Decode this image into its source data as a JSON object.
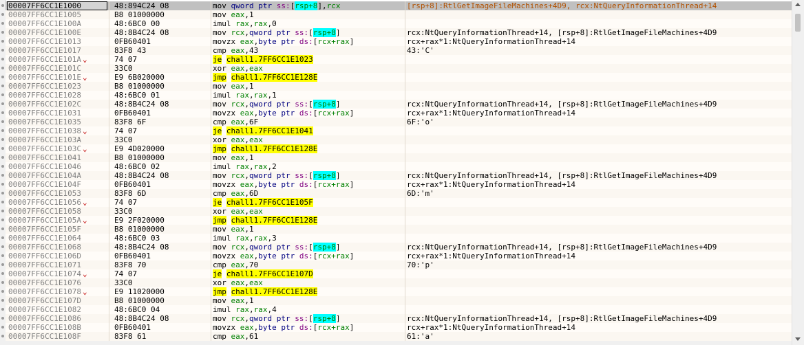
{
  "rows": [
    {
      "addr": "00007FF6CC1E1000",
      "bytes": "48:894C24 08",
      "ins": [
        [
          "mnem",
          "mov "
        ],
        [
          "kw",
          "qword ptr "
        ],
        [
          "seg",
          "ss:"
        ],
        [
          "br",
          "["
        ],
        [
          "regc",
          "rsp+8"
        ],
        [
          "br",
          "]"
        ],
        [
          "br",
          ","
        ],
        [
          "reg",
          "rcx"
        ]
      ],
      "cmt": "[rsp+8]:RtlGetImageFileMachines+4D9, rcx:NtQueryInformationThread+14",
      "cmt_color": "orange",
      "selected": true,
      "arrow": ""
    },
    {
      "addr": "00007FF6CC1E1005",
      "bytes": "B8 01000000",
      "ins": [
        [
          "mnem",
          "mov "
        ],
        [
          "reg",
          "eax"
        ],
        [
          "br",
          ","
        ],
        [
          "num",
          "1"
        ]
      ],
      "cmt": "",
      "arrow": ""
    },
    {
      "addr": "00007FF6CC1E100A",
      "bytes": "48:6BC0 00",
      "ins": [
        [
          "mnem",
          "imul "
        ],
        [
          "reg",
          "rax"
        ],
        [
          "br",
          ","
        ],
        [
          "reg",
          "rax"
        ],
        [
          "br",
          ","
        ],
        [
          "num",
          "0"
        ]
      ],
      "cmt": "",
      "arrow": ""
    },
    {
      "addr": "00007FF6CC1E100E",
      "bytes": "48:8B4C24 08",
      "ins": [
        [
          "mnem",
          "mov "
        ],
        [
          "reg",
          "rcx"
        ],
        [
          "br",
          ","
        ],
        [
          "kw",
          "qword ptr "
        ],
        [
          "seg",
          "ss:"
        ],
        [
          "br",
          "["
        ],
        [
          "regc",
          "rsp+8"
        ],
        [
          "br",
          "]"
        ]
      ],
      "cmt": "rcx:NtQueryInformationThread+14, [rsp+8]:RtlGetImageFileMachines+4D9",
      "arrow": ""
    },
    {
      "addr": "00007FF6CC1E1013",
      "bytes": "0FB60401",
      "ins": [
        [
          "mnem",
          "movzx "
        ],
        [
          "reg",
          "eax"
        ],
        [
          "br",
          ","
        ],
        [
          "kw",
          "byte ptr "
        ],
        [
          "seg",
          "ds:"
        ],
        [
          "br",
          "["
        ],
        [
          "reg",
          "rcx+rax"
        ],
        [
          "br",
          "]"
        ]
      ],
      "cmt": "rcx+rax*1:NtQueryInformationThread+14",
      "arrow": ""
    },
    {
      "addr": "00007FF6CC1E1017",
      "bytes": "83F8 43",
      "ins": [
        [
          "mnem",
          "cmp "
        ],
        [
          "reg",
          "eax"
        ],
        [
          "br",
          ","
        ],
        [
          "num",
          "43"
        ]
      ],
      "cmt": "43:'C'",
      "arrow": ""
    },
    {
      "addr": "00007FF6CC1E101A",
      "bytes": "74 07",
      "ins": [
        [
          "hl",
          "je"
        ],
        [
          "br",
          " "
        ],
        [
          "tgt",
          "chall1.7FF6CC1E1023"
        ]
      ],
      "cmt": "",
      "arrow": "⌄"
    },
    {
      "addr": "00007FF6CC1E101C",
      "bytes": "33C0",
      "ins": [
        [
          "mnem",
          "xor "
        ],
        [
          "reg",
          "eax"
        ],
        [
          "br",
          ","
        ],
        [
          "reg",
          "eax"
        ]
      ],
      "cmt": "",
      "arrow": ""
    },
    {
      "addr": "00007FF6CC1E101E",
      "bytes": "E9 6B020000",
      "ins": [
        [
          "hl",
          "jmp"
        ],
        [
          "br",
          " "
        ],
        [
          "tgt",
          "chall1.7FF6CC1E128E"
        ]
      ],
      "cmt": "",
      "arrow": "⌄"
    },
    {
      "addr": "00007FF6CC1E1023",
      "bytes": "B8 01000000",
      "ins": [
        [
          "mnem",
          "mov "
        ],
        [
          "reg",
          "eax"
        ],
        [
          "br",
          ","
        ],
        [
          "num",
          "1"
        ]
      ],
      "cmt": "",
      "arrow": ""
    },
    {
      "addr": "00007FF6CC1E1028",
      "bytes": "48:6BC0 01",
      "ins": [
        [
          "mnem",
          "imul "
        ],
        [
          "reg",
          "rax"
        ],
        [
          "br",
          ","
        ],
        [
          "reg",
          "rax"
        ],
        [
          "br",
          ","
        ],
        [
          "num",
          "1"
        ]
      ],
      "cmt": "",
      "arrow": ""
    },
    {
      "addr": "00007FF6CC1E102C",
      "bytes": "48:8B4C24 08",
      "ins": [
        [
          "mnem",
          "mov "
        ],
        [
          "reg",
          "rcx"
        ],
        [
          "br",
          ","
        ],
        [
          "kw",
          "qword ptr "
        ],
        [
          "seg",
          "ss:"
        ],
        [
          "br",
          "["
        ],
        [
          "regc",
          "rsp+8"
        ],
        [
          "br",
          "]"
        ]
      ],
      "cmt": "rcx:NtQueryInformationThread+14, [rsp+8]:RtlGetImageFileMachines+4D9",
      "arrow": ""
    },
    {
      "addr": "00007FF6CC1E1031",
      "bytes": "0FB60401",
      "ins": [
        [
          "mnem",
          "movzx "
        ],
        [
          "reg",
          "eax"
        ],
        [
          "br",
          ","
        ],
        [
          "kw",
          "byte ptr "
        ],
        [
          "seg",
          "ds:"
        ],
        [
          "br",
          "["
        ],
        [
          "reg",
          "rcx+rax"
        ],
        [
          "br",
          "]"
        ]
      ],
      "cmt": "rcx+rax*1:NtQueryInformationThread+14",
      "arrow": ""
    },
    {
      "addr": "00007FF6CC1E1035",
      "bytes": "83F8 6F",
      "ins": [
        [
          "mnem",
          "cmp "
        ],
        [
          "reg",
          "eax"
        ],
        [
          "br",
          ","
        ],
        [
          "num",
          "6F"
        ]
      ],
      "cmt": "6F:'o'",
      "arrow": ""
    },
    {
      "addr": "00007FF6CC1E1038",
      "bytes": "74 07",
      "ins": [
        [
          "hl",
          "je"
        ],
        [
          "br",
          " "
        ],
        [
          "tgt",
          "chall1.7FF6CC1E1041"
        ]
      ],
      "cmt": "",
      "arrow": "⌄"
    },
    {
      "addr": "00007FF6CC1E103A",
      "bytes": "33C0",
      "ins": [
        [
          "mnem",
          "xor "
        ],
        [
          "reg",
          "eax"
        ],
        [
          "br",
          ","
        ],
        [
          "reg",
          "eax"
        ]
      ],
      "cmt": "",
      "arrow": ""
    },
    {
      "addr": "00007FF6CC1E103C",
      "bytes": "E9 4D020000",
      "ins": [
        [
          "hl",
          "jmp"
        ],
        [
          "br",
          " "
        ],
        [
          "tgt",
          "chall1.7FF6CC1E128E"
        ]
      ],
      "cmt": "",
      "arrow": "⌄"
    },
    {
      "addr": "00007FF6CC1E1041",
      "bytes": "B8 01000000",
      "ins": [
        [
          "mnem",
          "mov "
        ],
        [
          "reg",
          "eax"
        ],
        [
          "br",
          ","
        ],
        [
          "num",
          "1"
        ]
      ],
      "cmt": "",
      "arrow": ""
    },
    {
      "addr": "00007FF6CC1E1046",
      "bytes": "48:6BC0 02",
      "ins": [
        [
          "mnem",
          "imul "
        ],
        [
          "reg",
          "rax"
        ],
        [
          "br",
          ","
        ],
        [
          "reg",
          "rax"
        ],
        [
          "br",
          ","
        ],
        [
          "num",
          "2"
        ]
      ],
      "cmt": "",
      "arrow": ""
    },
    {
      "addr": "00007FF6CC1E104A",
      "bytes": "48:8B4C24 08",
      "ins": [
        [
          "mnem",
          "mov "
        ],
        [
          "reg",
          "rcx"
        ],
        [
          "br",
          ","
        ],
        [
          "kw",
          "qword ptr "
        ],
        [
          "seg",
          "ss:"
        ],
        [
          "br",
          "["
        ],
        [
          "regc",
          "rsp+8"
        ],
        [
          "br",
          "]"
        ]
      ],
      "cmt": "rcx:NtQueryInformationThread+14, [rsp+8]:RtlGetImageFileMachines+4D9",
      "arrow": ""
    },
    {
      "addr": "00007FF6CC1E104F",
      "bytes": "0FB60401",
      "ins": [
        [
          "mnem",
          "movzx "
        ],
        [
          "reg",
          "eax"
        ],
        [
          "br",
          ","
        ],
        [
          "kw",
          "byte ptr "
        ],
        [
          "seg",
          "ds:"
        ],
        [
          "br",
          "["
        ],
        [
          "reg",
          "rcx+rax"
        ],
        [
          "br",
          "]"
        ]
      ],
      "cmt": "rcx+rax*1:NtQueryInformationThread+14",
      "arrow": ""
    },
    {
      "addr": "00007FF6CC1E1053",
      "bytes": "83F8 6D",
      "ins": [
        [
          "mnem",
          "cmp "
        ],
        [
          "reg",
          "eax"
        ],
        [
          "br",
          ","
        ],
        [
          "num",
          "6D"
        ]
      ],
      "cmt": "6D:'m'",
      "arrow": ""
    },
    {
      "addr": "00007FF6CC1E1056",
      "bytes": "74 07",
      "ins": [
        [
          "hl",
          "je"
        ],
        [
          "br",
          " "
        ],
        [
          "tgt",
          "chall1.7FF6CC1E105F"
        ]
      ],
      "cmt": "",
      "arrow": "⌄"
    },
    {
      "addr": "00007FF6CC1E1058",
      "bytes": "33C0",
      "ins": [
        [
          "mnem",
          "xor "
        ],
        [
          "reg",
          "eax"
        ],
        [
          "br",
          ","
        ],
        [
          "reg",
          "eax"
        ]
      ],
      "cmt": "",
      "arrow": ""
    },
    {
      "addr": "00007FF6CC1E105A",
      "bytes": "E9 2F020000",
      "ins": [
        [
          "hl",
          "jmp"
        ],
        [
          "br",
          " "
        ],
        [
          "tgt",
          "chall1.7FF6CC1E128E"
        ]
      ],
      "cmt": "",
      "arrow": "⌄"
    },
    {
      "addr": "00007FF6CC1E105F",
      "bytes": "B8 01000000",
      "ins": [
        [
          "mnem",
          "mov "
        ],
        [
          "reg",
          "eax"
        ],
        [
          "br",
          ","
        ],
        [
          "num",
          "1"
        ]
      ],
      "cmt": "",
      "arrow": ""
    },
    {
      "addr": "00007FF6CC1E1064",
      "bytes": "48:6BC0 03",
      "ins": [
        [
          "mnem",
          "imul "
        ],
        [
          "reg",
          "rax"
        ],
        [
          "br",
          ","
        ],
        [
          "reg",
          "rax"
        ],
        [
          "br",
          ","
        ],
        [
          "num",
          "3"
        ]
      ],
      "cmt": "",
      "arrow": ""
    },
    {
      "addr": "00007FF6CC1E1068",
      "bytes": "48:8B4C24 08",
      "ins": [
        [
          "mnem",
          "mov "
        ],
        [
          "reg",
          "rcx"
        ],
        [
          "br",
          ","
        ],
        [
          "kw",
          "qword ptr "
        ],
        [
          "seg",
          "ss:"
        ],
        [
          "br",
          "["
        ],
        [
          "regc",
          "rsp+8"
        ],
        [
          "br",
          "]"
        ]
      ],
      "cmt": "rcx:NtQueryInformationThread+14, [rsp+8]:RtlGetImageFileMachines+4D9",
      "arrow": ""
    },
    {
      "addr": "00007FF6CC1E106D",
      "bytes": "0FB60401",
      "ins": [
        [
          "mnem",
          "movzx "
        ],
        [
          "reg",
          "eax"
        ],
        [
          "br",
          ","
        ],
        [
          "kw",
          "byte ptr "
        ],
        [
          "seg",
          "ds:"
        ],
        [
          "br",
          "["
        ],
        [
          "reg",
          "rcx+rax"
        ],
        [
          "br",
          "]"
        ]
      ],
      "cmt": "rcx+rax*1:NtQueryInformationThread+14",
      "arrow": ""
    },
    {
      "addr": "00007FF6CC1E1071",
      "bytes": "83F8 70",
      "ins": [
        [
          "mnem",
          "cmp "
        ],
        [
          "reg",
          "eax"
        ],
        [
          "br",
          ","
        ],
        [
          "num",
          "70"
        ]
      ],
      "cmt": "70:'p'",
      "arrow": ""
    },
    {
      "addr": "00007FF6CC1E1074",
      "bytes": "74 07",
      "ins": [
        [
          "hl",
          "je"
        ],
        [
          "br",
          " "
        ],
        [
          "tgt",
          "chall1.7FF6CC1E107D"
        ]
      ],
      "cmt": "",
      "arrow": "⌄"
    },
    {
      "addr": "00007FF6CC1E1076",
      "bytes": "33C0",
      "ins": [
        [
          "mnem",
          "xor "
        ],
        [
          "reg",
          "eax"
        ],
        [
          "br",
          ","
        ],
        [
          "reg",
          "eax"
        ]
      ],
      "cmt": "",
      "arrow": ""
    },
    {
      "addr": "00007FF6CC1E1078",
      "bytes": "E9 11020000",
      "ins": [
        [
          "hl",
          "jmp"
        ],
        [
          "br",
          " "
        ],
        [
          "tgt",
          "chall1.7FF6CC1E128E"
        ]
      ],
      "cmt": "",
      "arrow": "⌄"
    },
    {
      "addr": "00007FF6CC1E107D",
      "bytes": "B8 01000000",
      "ins": [
        [
          "mnem",
          "mov "
        ],
        [
          "reg",
          "eax"
        ],
        [
          "br",
          ","
        ],
        [
          "num",
          "1"
        ]
      ],
      "cmt": "",
      "arrow": ""
    },
    {
      "addr": "00007FF6CC1E1082",
      "bytes": "48:6BC0 04",
      "ins": [
        [
          "mnem",
          "imul "
        ],
        [
          "reg",
          "rax"
        ],
        [
          "br",
          ","
        ],
        [
          "reg",
          "rax"
        ],
        [
          "br",
          ","
        ],
        [
          "num",
          "4"
        ]
      ],
      "cmt": "",
      "arrow": ""
    },
    {
      "addr": "00007FF6CC1E1086",
      "bytes": "48:8B4C24 08",
      "ins": [
        [
          "mnem",
          "mov "
        ],
        [
          "reg",
          "rcx"
        ],
        [
          "br",
          ","
        ],
        [
          "kw",
          "qword ptr "
        ],
        [
          "seg",
          "ss:"
        ],
        [
          "br",
          "["
        ],
        [
          "regc",
          "rsp+8"
        ],
        [
          "br",
          "]"
        ]
      ],
      "cmt": "rcx:NtQueryInformationThread+14, [rsp+8]:RtlGetImageFileMachines+4D9",
      "arrow": ""
    },
    {
      "addr": "00007FF6CC1E108B",
      "bytes": "0FB60401",
      "ins": [
        [
          "mnem",
          "movzx "
        ],
        [
          "reg",
          "eax"
        ],
        [
          "br",
          ","
        ],
        [
          "kw",
          "byte ptr "
        ],
        [
          "seg",
          "ds:"
        ],
        [
          "br",
          "["
        ],
        [
          "reg",
          "rcx+rax"
        ],
        [
          "br",
          "]"
        ]
      ],
      "cmt": "rcx+rax*1:NtQueryInformationThread+14",
      "arrow": ""
    },
    {
      "addr": "00007FF6CC1E108F",
      "bytes": "83F8 61",
      "ins": [
        [
          "mnem",
          "cmp "
        ],
        [
          "reg",
          "eax"
        ],
        [
          "br",
          ","
        ],
        [
          "num",
          "61"
        ]
      ],
      "cmt": "61:'a'",
      "arrow": ""
    }
  ]
}
